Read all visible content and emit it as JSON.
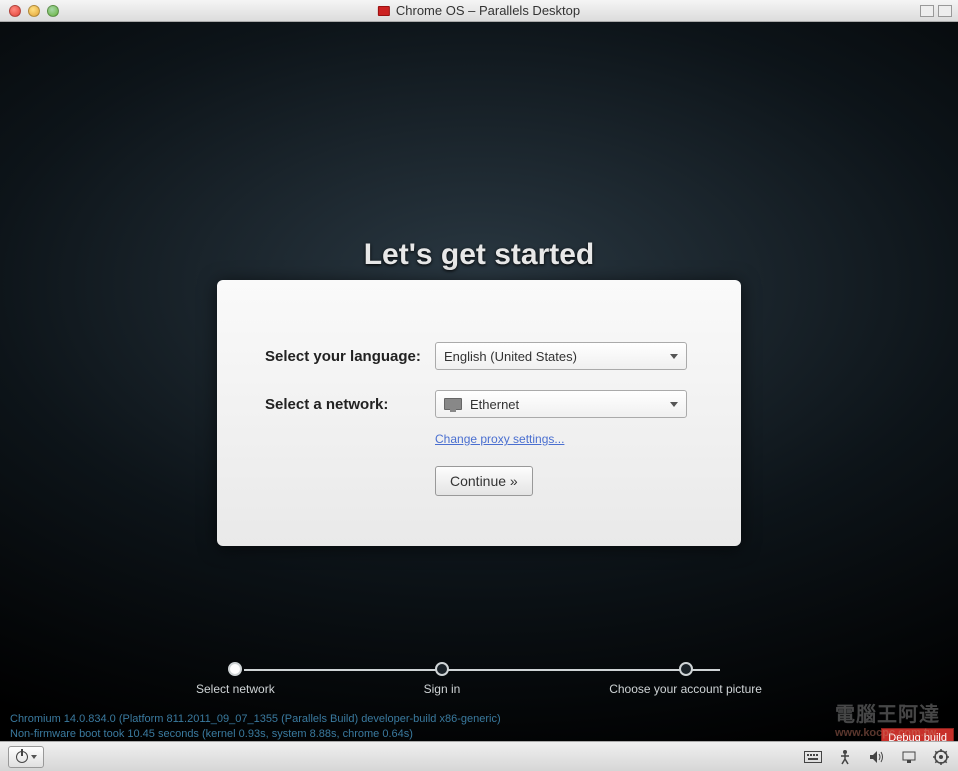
{
  "window": {
    "title": "Chrome OS – Parallels Desktop"
  },
  "setup": {
    "heading": "Let's get started",
    "language_label": "Select your language:",
    "language_value": "English (United States)",
    "network_label": "Select a network:",
    "network_value": "Ethernet",
    "proxy_link": "Change proxy settings...",
    "continue_label": "Continue »"
  },
  "stepper": {
    "steps": [
      "Select network",
      "Sign in",
      "Choose your account picture"
    ],
    "active_index": 0
  },
  "version": {
    "line1": "Chromium 14.0.834.0 (Platform 811.2011_09_07_1355 (Parallels Build)  developer-build x86-generic)",
    "line2": "Non-firmware boot took 10.45 seconds (kernel 0.93s, system 8.88s, chrome 0.64s)"
  },
  "debug_label": "Debug build",
  "watermark": {
    "main": "電腦王阿達",
    "sub": "www.kocpc.com.tw"
  }
}
